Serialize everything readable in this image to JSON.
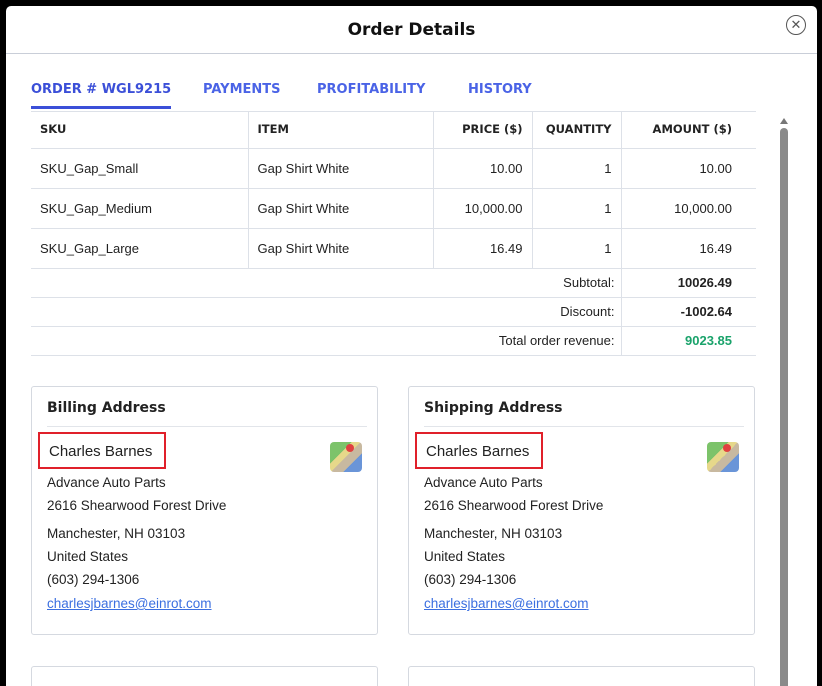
{
  "title": "Order Details",
  "tabs": [
    "ORDER # WGL9215",
    "PAYMENTS",
    "PROFITABILITY",
    "HISTORY"
  ],
  "table": {
    "headers": [
      "SKU",
      "ITEM",
      "PRICE ($)",
      "QUANTITY",
      "AMOUNT ($)"
    ],
    "rows": [
      [
        "SKU_Gap_Small",
        "Gap Shirt White",
        "10.00",
        "1",
        "10.00"
      ],
      [
        "SKU_Gap_Medium",
        "Gap Shirt White",
        "10,000.00",
        "1",
        "10,000.00"
      ],
      [
        "SKU_Gap_Large",
        "Gap Shirt White",
        "16.49",
        "1",
        "16.49"
      ]
    ],
    "subtotal_label": "Subtotal:",
    "subtotal": "10026.49",
    "discount_label": "Discount:",
    "discount": "-1002.64",
    "total_label": "Total order revenue:",
    "total": "9023.85"
  },
  "billing": {
    "title": "Billing Address",
    "name": "Charles Barnes",
    "company": "Advance Auto Parts",
    "street": "2616 Shearwood Forest Drive",
    "city": "Manchester, NH 03103",
    "country": "United States",
    "phone": "(603) 294-1306",
    "email": "charlesjbarnes@einrot.com"
  },
  "shipping": {
    "title": "Shipping Address",
    "name": "Charles Barnes",
    "company": "Advance Auto Parts",
    "street": "2616 Shearwood Forest Drive",
    "city": "Manchester, NH 03103",
    "country": "United States",
    "phone": "(603) 294-1306",
    "email": "charlesjbarnes@einrot.com"
  }
}
